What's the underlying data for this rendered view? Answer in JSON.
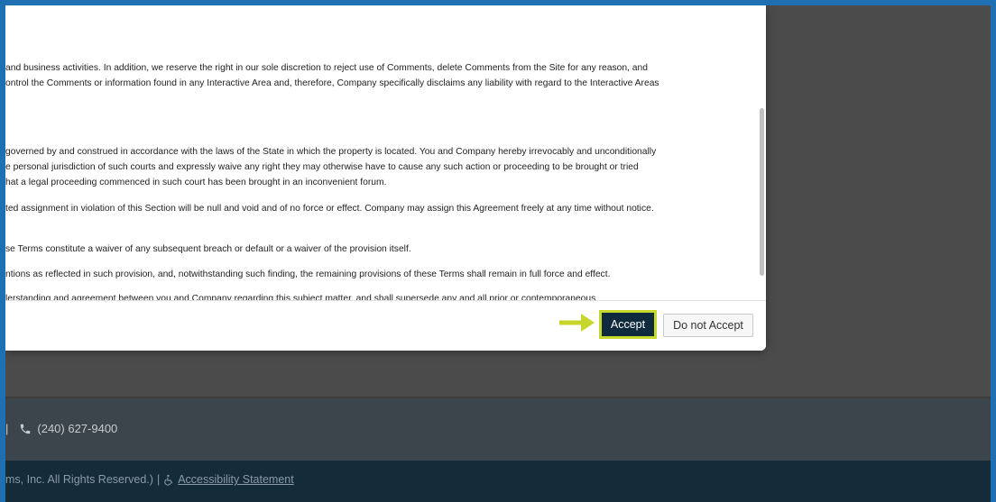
{
  "modal": {
    "terms_lines": [
      "and business activities. In addition, we reserve the right in our sole discretion to reject use of Comments, delete Comments from the Site for any reason, and",
      "ontrol the Comments or information found in any Interactive Area and, therefore, Company specifically disclaims any liability with regard to the Interactive Areas",
      "governed by and construed in accordance with the laws of the State in which the property is located. You and Company hereby irrevocably and unconditionally",
      "e personal jurisdiction of such courts and expressly waive any right they may otherwise have to cause any such action or proceeding to be brought or tried",
      "hat a legal proceeding commenced in such court has been brought in an inconvenient forum.",
      "ted assignment in violation of this Section will be null and void and of no force or effect. Company may assign this Agreement freely at any time without notice.",
      "se Terms constitute a waiver of any subsequent breach or default or a waiver of the provision itself.",
      "ntions as reflected in such provision, and, notwithstanding such finding, the remaining provisions of these Terms shall remain in full force and effect.",
      "lerstanding and agreement between you and Company regarding this subject matter, and shall supersede any and all prior or contemporaneous"
    ],
    "accept_label": "Accept",
    "reject_label": "Do not Accept",
    "arrow_icon": "arrow-right-icon"
  },
  "contact": {
    "separator": "|",
    "phone": "(240) 627-9400",
    "phone_icon": "phone-icon"
  },
  "footer": {
    "copyright": "ms, Inc. All Rights Reserved.)",
    "separator": "|",
    "accessibility_label": "Accessibility Statement",
    "accessibility_icon": "accessibility-icon"
  },
  "colors": {
    "accept_bg": "#0f2a3d",
    "accept_border": "#c7d62a",
    "arrow": "#c7d62a",
    "frame": "#1f6fb3"
  }
}
